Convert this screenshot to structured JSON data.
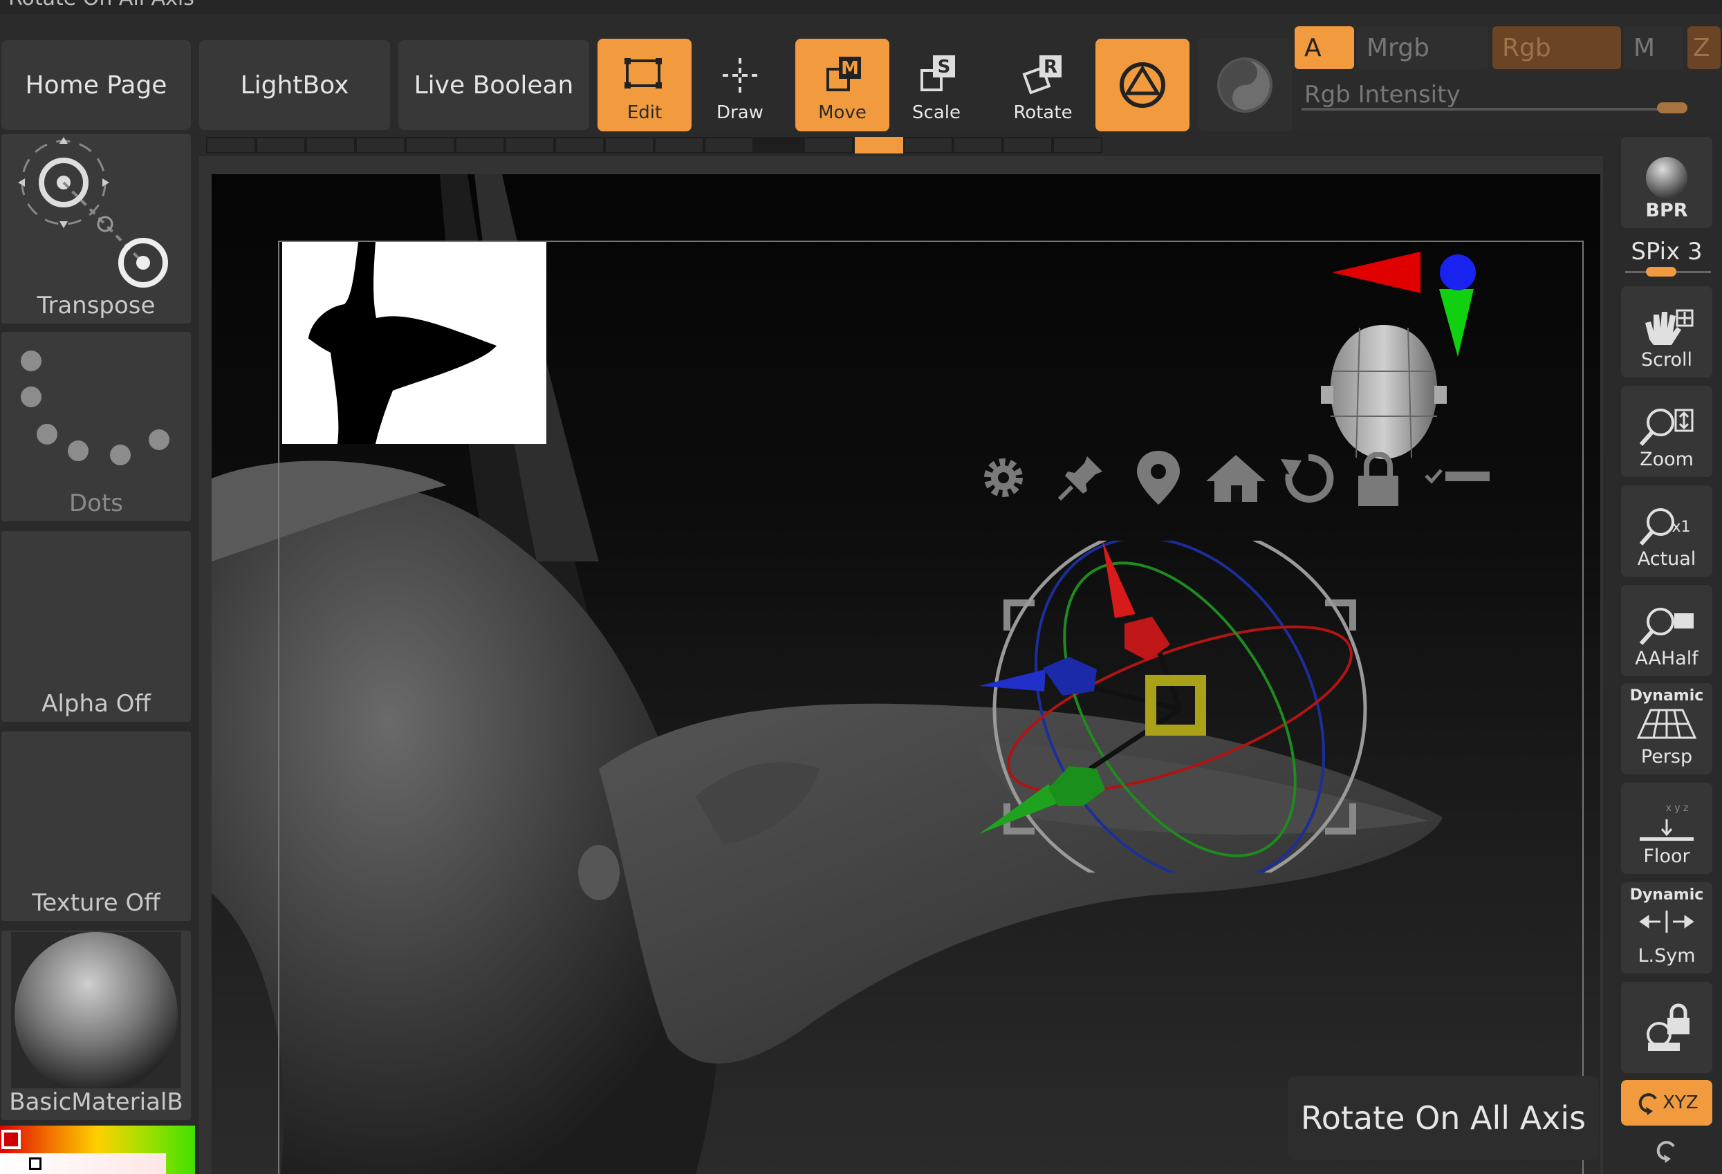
{
  "window": {
    "title": "Rotate On All Axis"
  },
  "nav": {
    "home": "Home Page",
    "lightbox": "LightBox",
    "live_boolean": "Live Boolean"
  },
  "tools": {
    "edit": "Edit",
    "draw": "Draw",
    "move": "Move",
    "scale": "Scale",
    "rotate": "Rotate",
    "move_key": "M",
    "scale_key": "S",
    "rotate_key": "R"
  },
  "color_modes": {
    "a": "A",
    "mrgb": "Mrgb",
    "rgb": "Rgb",
    "m": "M",
    "z": "Z",
    "rgb_intensity": "Rgb Intensity"
  },
  "left_panel": {
    "transpose": "Transpose",
    "dots": "Dots",
    "alpha": "Alpha Off",
    "texture": "Texture Off",
    "material": "BasicMaterialB"
  },
  "right_panel": {
    "bpr": "BPR",
    "spix": "SPix 3",
    "scroll": "Scroll",
    "zoom": "Zoom",
    "actual": "Actual",
    "aahalf": "AAHalf",
    "dynamic": "Dynamic",
    "persp": "Persp",
    "floor": "Floor",
    "lsym": "L.Sym",
    "xyz": "XYZ"
  },
  "tooltip": {
    "text": "Rotate On All Axis"
  },
  "colors": {
    "accent": "#f19a3e",
    "panel": "#383838",
    "x_axis": "#d81a1a",
    "y_axis": "#1fa31f",
    "z_axis": "#1330c8",
    "pivot": "#a9a218"
  }
}
